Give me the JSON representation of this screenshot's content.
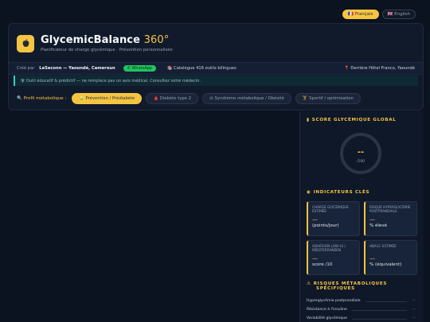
{
  "lang": {
    "fr": "🇫🇷 Français",
    "en": "🇬🇧 English"
  },
  "header": {
    "title": "GlycemicBalance",
    "title_accent": "360°",
    "subtitle": "Planificateur de charge glycémique · Prévention personnalisée",
    "logo_icon": "apple-icon"
  },
  "meta": {
    "created_by": "Créé par",
    "author": "LeSeconn — Yaoundé, Cameroun",
    "whatsapp": "✆ WhatsApp",
    "catalogue": "📚 Catalogue 416 outils bilingues",
    "location": "📍 Derrière Hôtel Franco, Yaoundé"
  },
  "notice": "🛡 Outil éducatif & prédictif — ne remplace pas un avis médical. Consultez votre médecin.",
  "profile": {
    "label": "🔍 Profil métabolique :",
    "options": [
      {
        "label": "🍃 Prévention / Prédiabète",
        "active": true
      },
      {
        "label": "🩸 Diabète type 2",
        "active": false
      },
      {
        "label": "⚖ Syndrome métabolique / Obésité",
        "active": false
      },
      {
        "label": "🏋 Sportif / optimisation",
        "active": false
      }
    ]
  },
  "score": {
    "title": "SCORE GLYCÉMIQUE GLOBAL",
    "value": "--",
    "unit": "/100",
    "below": "–"
  },
  "indicators": {
    "title": "INDICATEURS CLÉS",
    "items": [
      {
        "label": "CHARGE GLYCÉMIQUE ESTIMÉE",
        "value": "—",
        "unit": "(points/jour)"
      },
      {
        "label": "RISQUE HYPERGLYCÉMIE POSTPRANDIALE",
        "value": "—",
        "unit": "% élevé"
      },
      {
        "label": "ADHÉSION LOW-GI / MÉDITERRANÉEN",
        "value": "—",
        "unit": "score /10"
      },
      {
        "label": "HBA1C ESTIMÉE",
        "value": "—",
        "unit": "% (équivalent)"
      }
    ]
  },
  "risks": {
    "title_line1": "RISQUES MÉTABOLIQUES",
    "title_line2": "SPÉCIFIQUES",
    "items": [
      {
        "label": "Hyperglycémie postprandiale",
        "value": "—"
      },
      {
        "label": "Résistance à l'insuline",
        "value": "—"
      },
      {
        "label": "Variabilité glycémique",
        "value": "—"
      }
    ]
  },
  "colors": {
    "accent": "#f5c542",
    "background": "#0b1220",
    "whatsapp": "#22c55e"
  }
}
